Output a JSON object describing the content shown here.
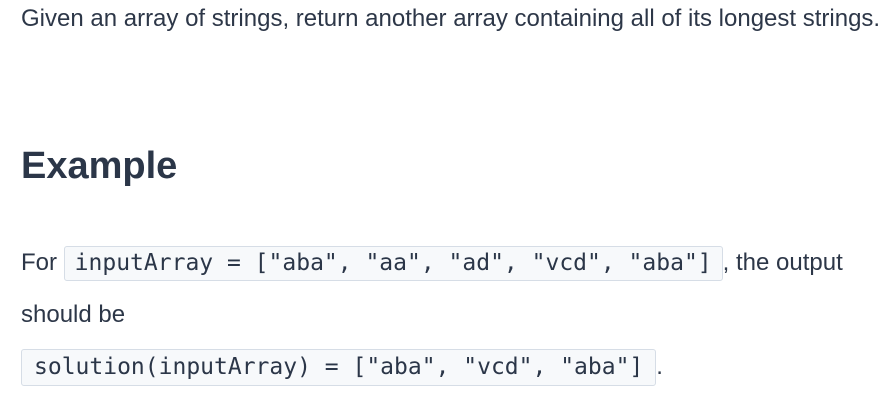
{
  "intro": "Given an array of strings, return another array containing all of its longest strings.",
  "heading": "Example",
  "example": {
    "prefix": "For",
    "input_code": "inputArray = [\"aba\", \"aa\", \"ad\", \"vcd\", \"aba\"]",
    "middle": ", the output should be",
    "output_code": "solution(inputArray) = [\"aba\", \"vcd\", \"aba\"]",
    "suffix": "."
  }
}
